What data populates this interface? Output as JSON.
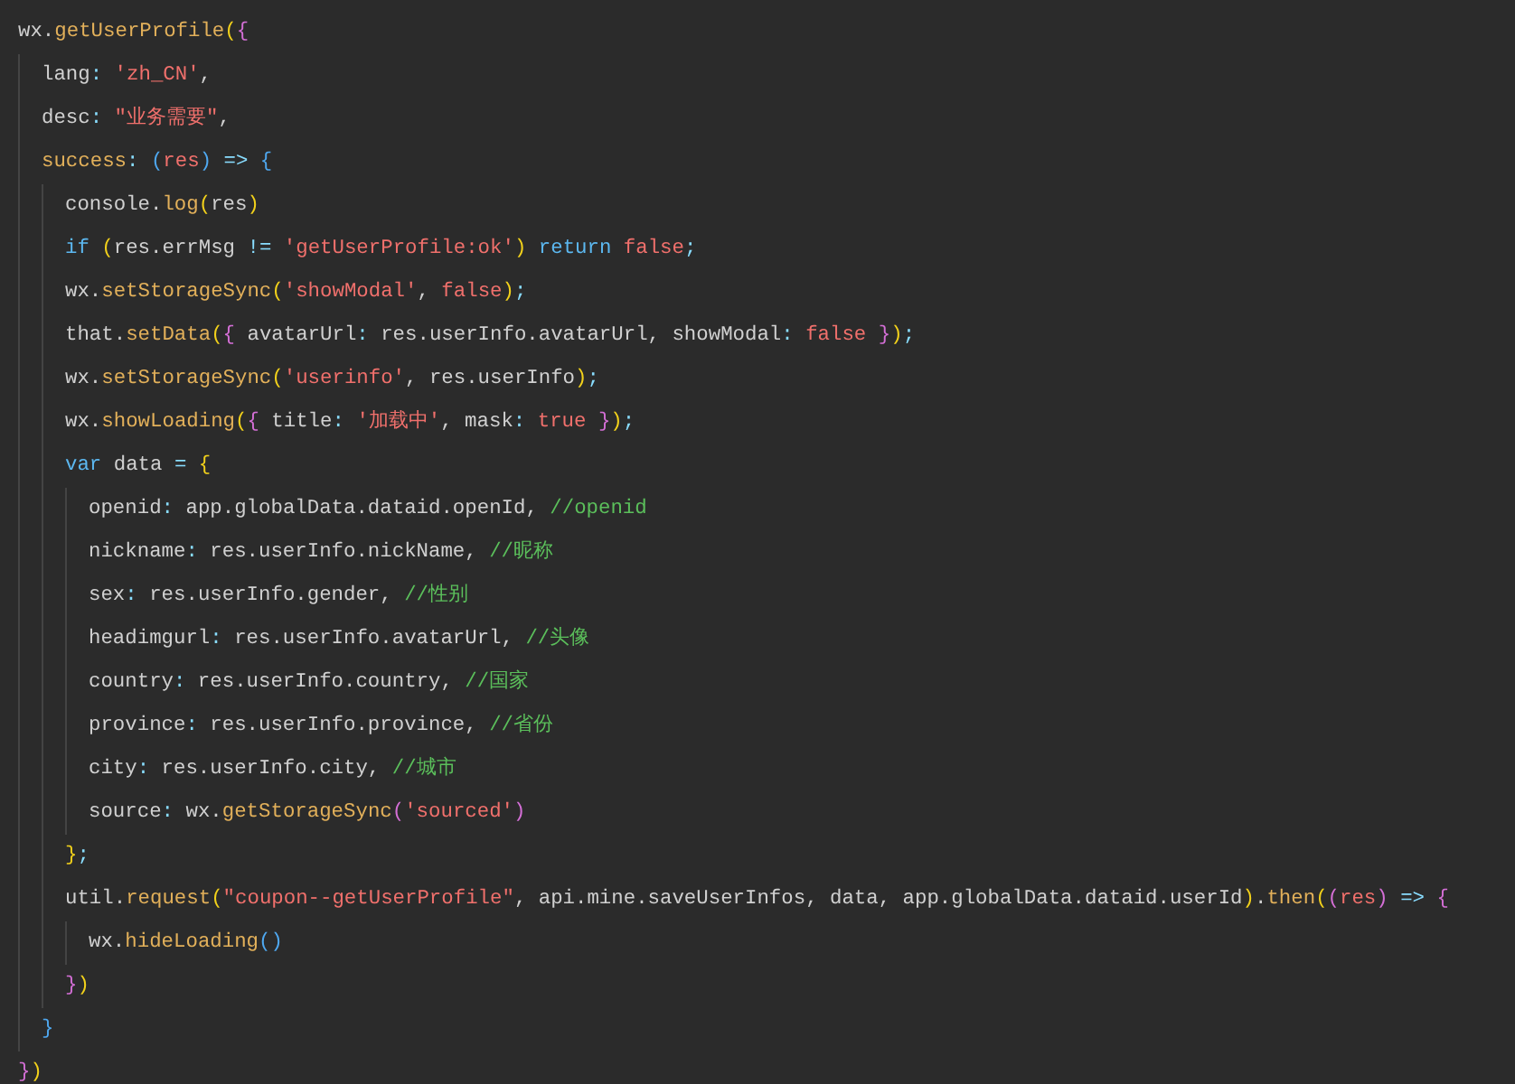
{
  "editor": {
    "lines": [
      {
        "tokens": [
          {
            "text": "wx.",
            "kind": "text"
          },
          {
            "text": "getUserProfile",
            "kind": "func"
          },
          {
            "text": "(",
            "kind": "brace1"
          },
          {
            "text": "{",
            "kind": "brace2"
          }
        ],
        "children": [
          {
            "tokens": [
              {
                "text": "lang",
                "kind": "text"
              },
              {
                "text": ": ",
                "kind": "op"
              },
              {
                "text": "'zh_CN'",
                "kind": "string"
              },
              {
                "text": ",",
                "kind": "text"
              }
            ]
          },
          {
            "tokens": [
              {
                "text": "desc",
                "kind": "text"
              },
              {
                "text": ": ",
                "kind": "op"
              },
              {
                "text": "\"业务需要\"",
                "kind": "string"
              },
              {
                "text": ",",
                "kind": "text"
              }
            ]
          },
          {
            "tokens": [
              {
                "text": "success",
                "kind": "func"
              },
              {
                "text": ": ",
                "kind": "op"
              },
              {
                "text": "(",
                "kind": "brace3"
              },
              {
                "text": "res",
                "kind": "literal"
              },
              {
                "text": ")",
                "kind": "brace3"
              },
              {
                "text": " => ",
                "kind": "op"
              },
              {
                "text": "{",
                "kind": "brace3"
              }
            ],
            "children": [
              {
                "tokens": [
                  {
                    "text": "console.",
                    "kind": "text"
                  },
                  {
                    "text": "log",
                    "kind": "func"
                  },
                  {
                    "text": "(",
                    "kind": "brace1"
                  },
                  {
                    "text": "res",
                    "kind": "text"
                  },
                  {
                    "text": ")",
                    "kind": "brace1"
                  }
                ]
              },
              {
                "tokens": [
                  {
                    "text": "if ",
                    "kind": "keyword"
                  },
                  {
                    "text": "(",
                    "kind": "brace1"
                  },
                  {
                    "text": "res.errMsg ",
                    "kind": "text"
                  },
                  {
                    "text": "!= ",
                    "kind": "op"
                  },
                  {
                    "text": "'getUserProfile:ok'",
                    "kind": "string"
                  },
                  {
                    "text": ")",
                    "kind": "brace1"
                  },
                  {
                    "text": " return ",
                    "kind": "keyword"
                  },
                  {
                    "text": "false",
                    "kind": "literal"
                  },
                  {
                    "text": ";",
                    "kind": "op"
                  }
                ]
              },
              {
                "tokens": [
                  {
                    "text": "wx.",
                    "kind": "text"
                  },
                  {
                    "text": "setStorageSync",
                    "kind": "func"
                  },
                  {
                    "text": "(",
                    "kind": "brace1"
                  },
                  {
                    "text": "'showModal'",
                    "kind": "string"
                  },
                  {
                    "text": ", ",
                    "kind": "text"
                  },
                  {
                    "text": "false",
                    "kind": "literal"
                  },
                  {
                    "text": ")",
                    "kind": "brace1"
                  },
                  {
                    "text": ";",
                    "kind": "op"
                  }
                ]
              },
              {
                "tokens": [
                  {
                    "text": "that.",
                    "kind": "text"
                  },
                  {
                    "text": "setData",
                    "kind": "func"
                  },
                  {
                    "text": "(",
                    "kind": "brace1"
                  },
                  {
                    "text": "{",
                    "kind": "brace2"
                  },
                  {
                    "text": " avatarUrl",
                    "kind": "text"
                  },
                  {
                    "text": ":",
                    "kind": "op"
                  },
                  {
                    "text": " res.userInfo.avatarUrl, showModal",
                    "kind": "text"
                  },
                  {
                    "text": ": ",
                    "kind": "op"
                  },
                  {
                    "text": "false ",
                    "kind": "literal"
                  },
                  {
                    "text": "}",
                    "kind": "brace2"
                  },
                  {
                    "text": ")",
                    "kind": "brace1"
                  },
                  {
                    "text": ";",
                    "kind": "op"
                  }
                ]
              },
              {
                "tokens": [
                  {
                    "text": "wx.",
                    "kind": "text"
                  },
                  {
                    "text": "setStorageSync",
                    "kind": "func"
                  },
                  {
                    "text": "(",
                    "kind": "brace1"
                  },
                  {
                    "text": "'userinfo'",
                    "kind": "string"
                  },
                  {
                    "text": ", res.userInfo",
                    "kind": "text"
                  },
                  {
                    "text": ")",
                    "kind": "brace1"
                  },
                  {
                    "text": ";",
                    "kind": "op"
                  }
                ]
              },
              {
                "tokens": [
                  {
                    "text": "wx.",
                    "kind": "text"
                  },
                  {
                    "text": "showLoading",
                    "kind": "func"
                  },
                  {
                    "text": "(",
                    "kind": "brace1"
                  },
                  {
                    "text": "{",
                    "kind": "brace2"
                  },
                  {
                    "text": " title",
                    "kind": "text"
                  },
                  {
                    "text": ": ",
                    "kind": "op"
                  },
                  {
                    "text": "'加载中'",
                    "kind": "string"
                  },
                  {
                    "text": ", mask",
                    "kind": "text"
                  },
                  {
                    "text": ": ",
                    "kind": "op"
                  },
                  {
                    "text": "true ",
                    "kind": "literal"
                  },
                  {
                    "text": "}",
                    "kind": "brace2"
                  },
                  {
                    "text": ")",
                    "kind": "brace1"
                  },
                  {
                    "text": ";",
                    "kind": "op"
                  }
                ]
              },
              {
                "tokens": [
                  {
                    "text": "var",
                    "kind": "keyword"
                  },
                  {
                    "text": " data ",
                    "kind": "text"
                  },
                  {
                    "text": "= ",
                    "kind": "op"
                  },
                  {
                    "text": "{",
                    "kind": "brace1"
                  }
                ],
                "children": [
                  {
                    "tokens": [
                      {
                        "text": "openid",
                        "kind": "text"
                      },
                      {
                        "text": ":",
                        "kind": "op"
                      },
                      {
                        "text": " app.globalData.dataid.openId, ",
                        "kind": "text"
                      },
                      {
                        "text": "//openid",
                        "kind": "comment"
                      }
                    ]
                  },
                  {
                    "tokens": [
                      {
                        "text": "nickname",
                        "kind": "text"
                      },
                      {
                        "text": ":",
                        "kind": "op"
                      },
                      {
                        "text": " res.userInfo.nickName, ",
                        "kind": "text"
                      },
                      {
                        "text": "//昵称",
                        "kind": "comment"
                      }
                    ]
                  },
                  {
                    "tokens": [
                      {
                        "text": "sex",
                        "kind": "text"
                      },
                      {
                        "text": ":",
                        "kind": "op"
                      },
                      {
                        "text": " res.userInfo.gender, ",
                        "kind": "text"
                      },
                      {
                        "text": "//性别",
                        "kind": "comment"
                      }
                    ]
                  },
                  {
                    "tokens": [
                      {
                        "text": "headimgurl",
                        "kind": "text"
                      },
                      {
                        "text": ":",
                        "kind": "op"
                      },
                      {
                        "text": " res.userInfo.avatarUrl, ",
                        "kind": "text"
                      },
                      {
                        "text": "//头像",
                        "kind": "comment"
                      }
                    ]
                  },
                  {
                    "tokens": [
                      {
                        "text": "country",
                        "kind": "text"
                      },
                      {
                        "text": ":",
                        "kind": "op"
                      },
                      {
                        "text": " res.userInfo.country, ",
                        "kind": "text"
                      },
                      {
                        "text": "//国家",
                        "kind": "comment"
                      }
                    ]
                  },
                  {
                    "tokens": [
                      {
                        "text": "province",
                        "kind": "text"
                      },
                      {
                        "text": ":",
                        "kind": "op"
                      },
                      {
                        "text": " res.userInfo.province, ",
                        "kind": "text"
                      },
                      {
                        "text": "//省份",
                        "kind": "comment"
                      }
                    ]
                  },
                  {
                    "tokens": [
                      {
                        "text": "city",
                        "kind": "text"
                      },
                      {
                        "text": ":",
                        "kind": "op"
                      },
                      {
                        "text": " res.userInfo.city, ",
                        "kind": "text"
                      },
                      {
                        "text": "//城市",
                        "kind": "comment"
                      }
                    ]
                  },
                  {
                    "tokens": [
                      {
                        "text": "source",
                        "kind": "text"
                      },
                      {
                        "text": ":",
                        "kind": "op"
                      },
                      {
                        "text": " wx.",
                        "kind": "text"
                      },
                      {
                        "text": "getStorageSync",
                        "kind": "func"
                      },
                      {
                        "text": "(",
                        "kind": "brace2"
                      },
                      {
                        "text": "'sourced'",
                        "kind": "string"
                      },
                      {
                        "text": ")",
                        "kind": "brace2"
                      }
                    ]
                  }
                ]
              },
              {
                "tokens": [
                  {
                    "text": "}",
                    "kind": "brace1"
                  },
                  {
                    "text": ";",
                    "kind": "op"
                  }
                ]
              },
              {
                "tokens": [
                  {
                    "text": "util.",
                    "kind": "text"
                  },
                  {
                    "text": "request",
                    "kind": "func"
                  },
                  {
                    "text": "(",
                    "kind": "brace1"
                  },
                  {
                    "text": "\"coupon--getUserProfile\"",
                    "kind": "string"
                  },
                  {
                    "text": ", api.mine.saveUserInfos, data, app.globalData.dataid.userId",
                    "kind": "text"
                  },
                  {
                    "text": ")",
                    "kind": "brace1"
                  },
                  {
                    "text": ".",
                    "kind": "text"
                  },
                  {
                    "text": "then",
                    "kind": "func"
                  },
                  {
                    "text": "(",
                    "kind": "brace1"
                  },
                  {
                    "text": "(",
                    "kind": "brace2"
                  },
                  {
                    "text": "res",
                    "kind": "literal"
                  },
                  {
                    "text": ")",
                    "kind": "brace2"
                  },
                  {
                    "text": " => ",
                    "kind": "op"
                  },
                  {
                    "text": "{",
                    "kind": "brace2"
                  }
                ],
                "children": [
                  {
                    "tokens": [
                      {
                        "text": "wx.",
                        "kind": "text"
                      },
                      {
                        "text": "hideLoading",
                        "kind": "func"
                      },
                      {
                        "text": "(",
                        "kind": "brace3"
                      },
                      {
                        "text": ")",
                        "kind": "brace3"
                      }
                    ]
                  }
                ]
              },
              {
                "tokens": [
                  {
                    "text": "}",
                    "kind": "brace2"
                  },
                  {
                    "text": ")",
                    "kind": "brace1"
                  }
                ]
              }
            ]
          },
          {
            "tokens": [
              {
                "text": "}",
                "kind": "brace3"
              }
            ]
          }
        ]
      },
      {
        "tokens": [
          {
            "text": "}",
            "kind": "brace2"
          },
          {
            "text": ")",
            "kind": "brace1"
          }
        ]
      }
    ]
  }
}
